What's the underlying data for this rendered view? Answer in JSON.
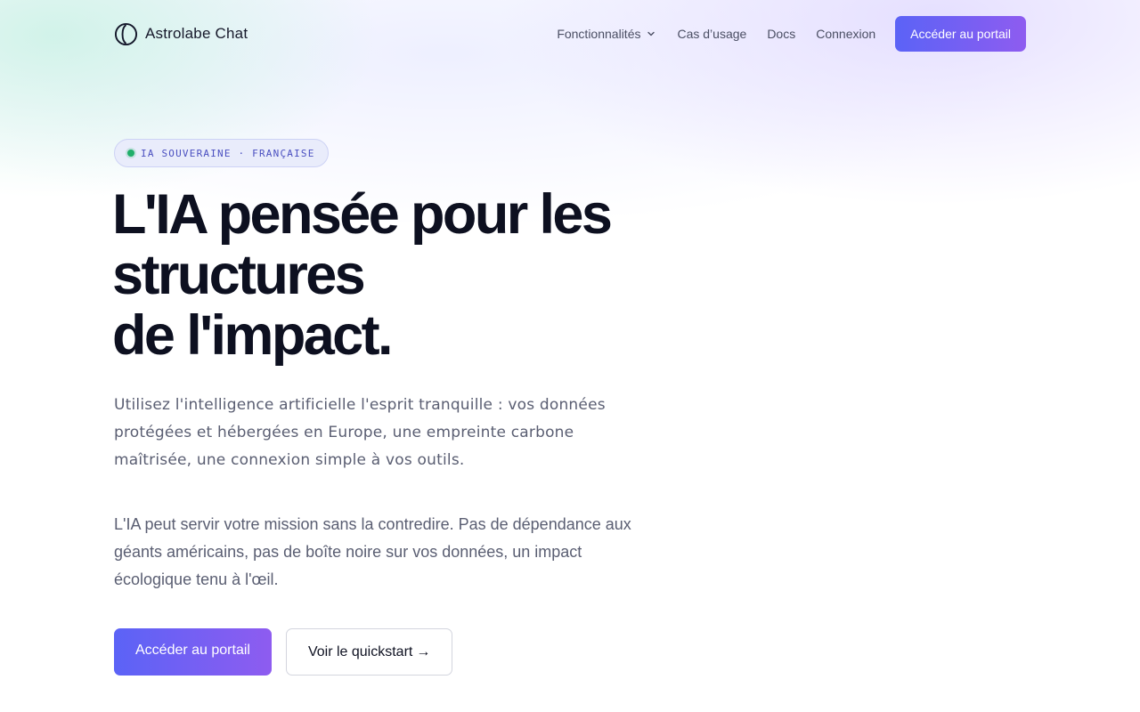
{
  "brand": {
    "name": "Astrolabe Chat",
    "logo_icon": "astrolabe-logo-icon"
  },
  "nav": {
    "items": [
      {
        "label": "Fonctionnalités",
        "has_dropdown": true,
        "icon": "chevron-down-icon"
      },
      {
        "label": "Cas d’usage"
      },
      {
        "label": "Docs"
      },
      {
        "label": "Connexion"
      }
    ],
    "cta_label": "Accéder au portail"
  },
  "hero": {
    "badge": "IA SOUVERAINE · FRANÇAISE",
    "title_lines": [
      "L'IA pensée pour les",
      "structures",
      "de l'impact."
    ],
    "lead": "Utilisez l'intelligence artificielle l'esprit tranquille : vos données protégées et hébergées en Europe, une empreinte carbone maîtrisée, une connexion simple à vos outils.",
    "body": "L'IA peut servir votre mission sans la contredire. Pas de dépendance aux géants américains, pas de boîte noire sur vos données, un impact écologique tenu à l'œil.",
    "cta_primary": "Accéder au portail",
    "cta_secondary": "Voir le quickstart",
    "cta_secondary_arrow": "→"
  },
  "colors": {
    "accent_start": "#5b63f6",
    "accent_end": "#8e5cf0",
    "badge_dot": "#1fae6a",
    "badge_text": "#4a4fc0",
    "text_primary": "#0d1020",
    "text_muted": "#5a5e72"
  }
}
